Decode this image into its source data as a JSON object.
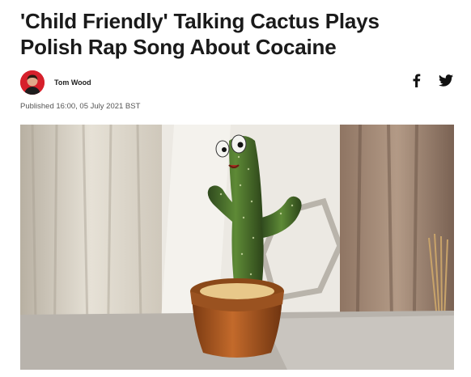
{
  "article": {
    "headline_line1": "'Child Friendly' Talking Cactus Plays",
    "headline_line2": "Polish Rap Song About Cocaine",
    "author": "Tom Wood",
    "published": "Published 16:00, 05 July 2021 BST"
  },
  "share": {
    "icons": [
      "facebook-icon",
      "twitter-icon"
    ]
  },
  "colors": {
    "headline": "#1a1a1a",
    "avatar_bg": "#d6202b",
    "meta_text": "#555555"
  }
}
